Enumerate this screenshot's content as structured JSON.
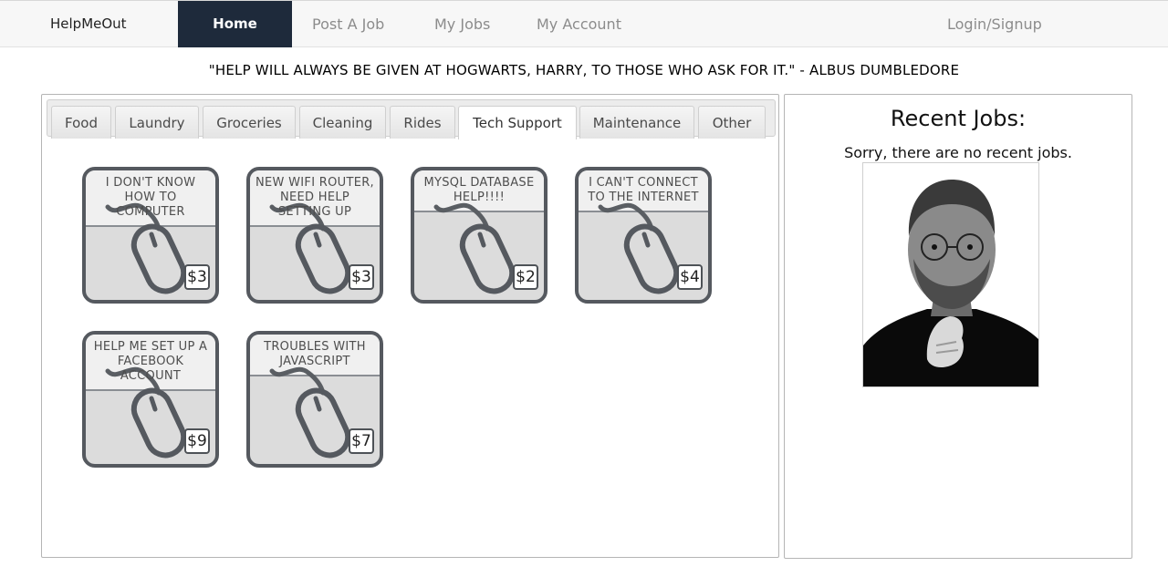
{
  "nav": {
    "brand": "HelpMeOut",
    "items": [
      {
        "label": "Home",
        "active": true
      },
      {
        "label": "Post A Job",
        "active": false
      },
      {
        "label": "My Jobs",
        "active": false
      },
      {
        "label": "My Account",
        "active": false
      }
    ],
    "login": "Login/Signup"
  },
  "quote": "\"HELP WILL ALWAYS BE GIVEN AT HOGWARTS, HARRY, TO THOSE WHO ASK FOR IT.\" - ALBUS DUMBLEDORE",
  "tabs": [
    {
      "label": "Food",
      "active": false
    },
    {
      "label": "Laundry",
      "active": false
    },
    {
      "label": "Groceries",
      "active": false
    },
    {
      "label": "Cleaning",
      "active": false
    },
    {
      "label": "Rides",
      "active": false
    },
    {
      "label": "Tech Support",
      "active": true
    },
    {
      "label": "Maintenance",
      "active": false
    },
    {
      "label": "Other",
      "active": false
    }
  ],
  "jobs": [
    {
      "title": "I DON'T KNOW HOW TO COMPUTER",
      "price": "$3",
      "icon": "computer-mouse-icon"
    },
    {
      "title": "NEW WIFI ROUTER, NEED HELP SETTING UP",
      "price": "$3",
      "icon": "computer-mouse-icon"
    },
    {
      "title": "MYSQL DATABASE HELP!!!!",
      "price": "$2",
      "icon": "computer-mouse-icon"
    },
    {
      "title": "I CAN'T CONNECT TO THE INTERNET",
      "price": "$4",
      "icon": "computer-mouse-icon"
    },
    {
      "title": "HELP ME SET UP A FACEBOOK ACCOUNT",
      "price": "$9",
      "icon": "computer-mouse-icon"
    },
    {
      "title": "TROUBLES WITH JAVASCRIPT",
      "price": "$7",
      "icon": "computer-mouse-icon"
    }
  ],
  "recent": {
    "title": "Recent Jobs:",
    "message": "Sorry, there are no recent jobs.",
    "image_icon": "portrait-photo"
  },
  "colors": {
    "nav_active": "#1e2a3b",
    "card_border": "#55595f"
  }
}
